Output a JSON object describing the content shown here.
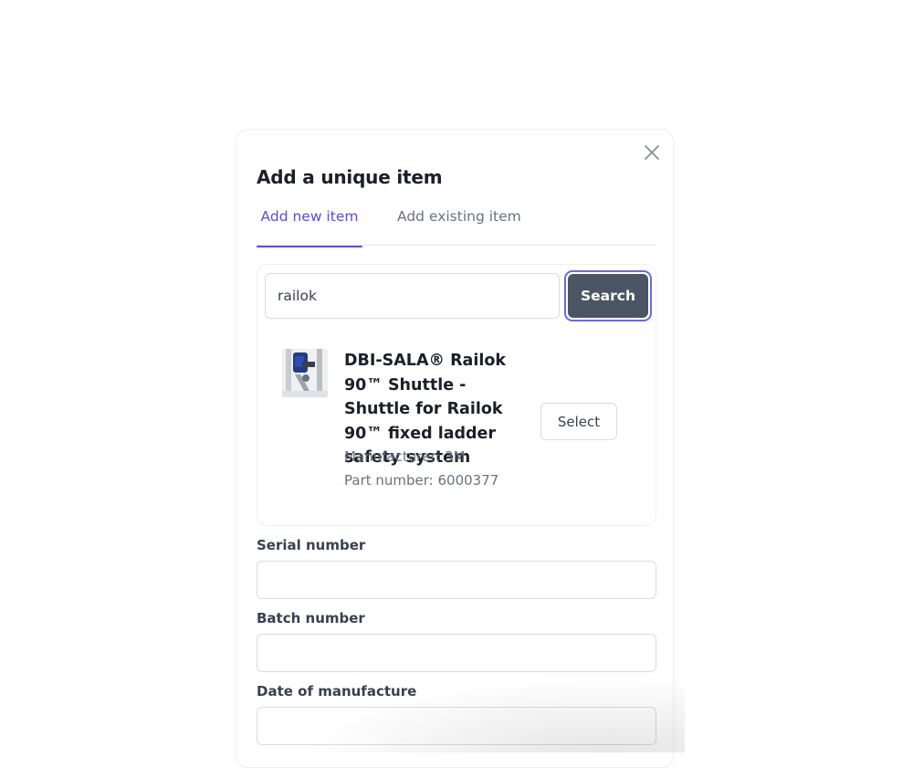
{
  "modal": {
    "title": "Add a unique item",
    "close_icon": "close-icon"
  },
  "tabs": [
    {
      "label": "Add new item",
      "active": true
    },
    {
      "label": "Add existing item",
      "active": false
    }
  ],
  "search": {
    "value": "railok",
    "button_label": "Search"
  },
  "result": {
    "name": "DBI-SALA® Railok 90™ Shuttle - Shuttle for Railok 90™ fixed ladder safety system",
    "manufacturer": "Manufacturer: 3M",
    "part_number": "Part number: 6000377",
    "select_label": "Select"
  },
  "fields": {
    "serial_label": "Serial number",
    "batch_label": "Batch number",
    "date_label": "Date of manufacture"
  },
  "colors": {
    "accent": "#5b4fd1",
    "search_button": "#4b5563"
  }
}
